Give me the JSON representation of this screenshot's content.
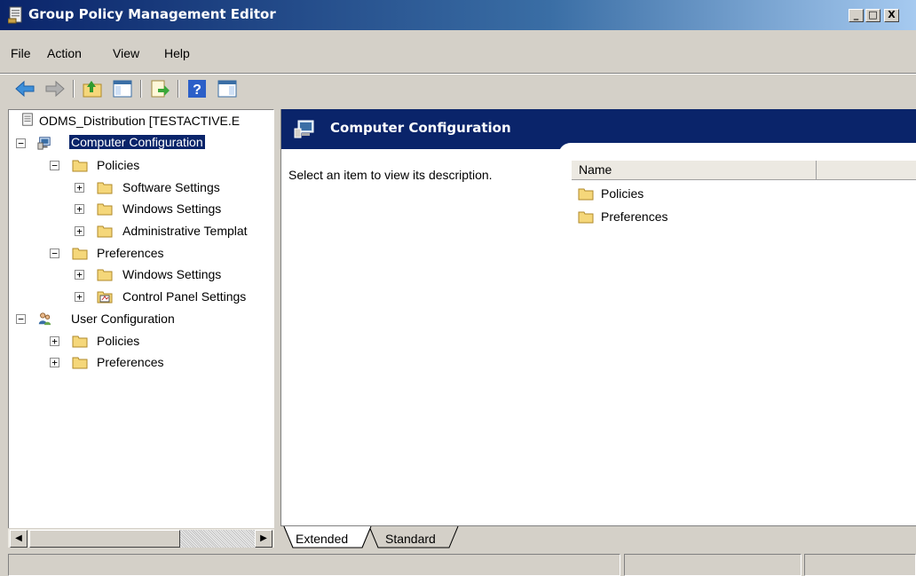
{
  "window": {
    "title": "Group Policy Management Editor",
    "buttons": {
      "minimize": "_",
      "maximize": "□",
      "close": "X"
    }
  },
  "menu": {
    "file": "File",
    "action": "Action",
    "view": "View",
    "help": "Help"
  },
  "toolbar": {
    "icons": [
      "back-arrow-icon",
      "forward-arrow-icon",
      "up-folder-icon",
      "show-hide-console-tree-icon",
      "export-list-icon",
      "help-icon",
      "show-action-pane-icon"
    ]
  },
  "tree": {
    "root": "ODMS_Distribution [TESTACTIVE.E",
    "computer_configuration": "Computer Configuration",
    "cc_policies": "Policies",
    "cc_software_settings": "Software Settings",
    "cc_windows_settings": "Windows Settings",
    "cc_admin_templates": "Administrative Templat",
    "cc_preferences": "Preferences",
    "cc_pref_windows_settings": "Windows Settings",
    "cc_pref_control_panel": "Control Panel Settings",
    "user_configuration": "User Configuration",
    "uc_policies": "Policies",
    "uc_preferences": "Preferences",
    "expanded_glyph": "−",
    "collapsed_glyph": "+"
  },
  "details": {
    "header_title": "Computer Configuration",
    "description": "Select an item to view its description.",
    "column_name": "Name",
    "items": [
      "Policies",
      "Preferences"
    ]
  },
  "tabs": {
    "extended": "Extended",
    "standard": "Standard"
  },
  "colors": {
    "selection": "#0a246a",
    "header_bg": "#0a246a",
    "chrome": "#d4d0c8",
    "folder": "#f5d77a"
  }
}
